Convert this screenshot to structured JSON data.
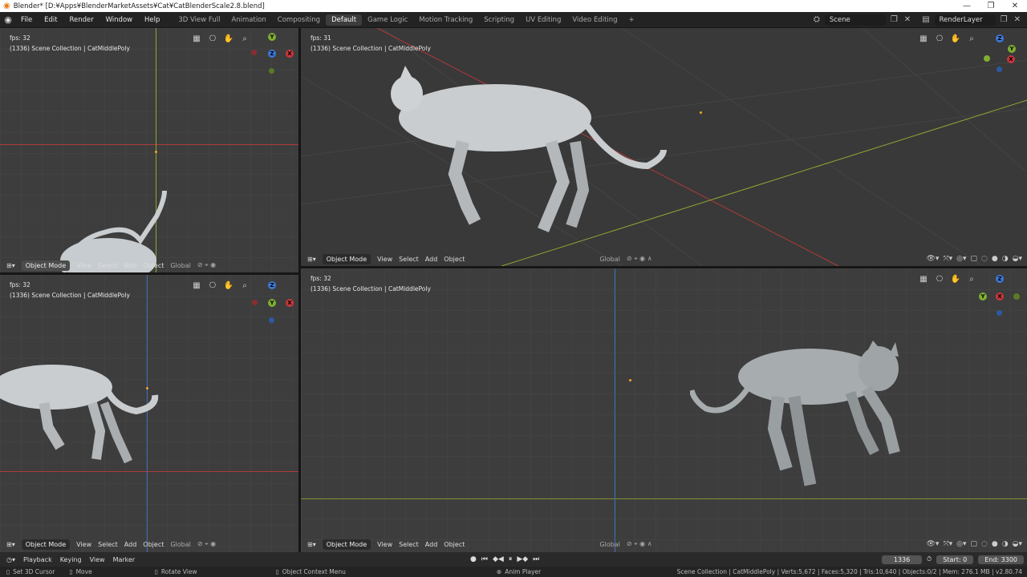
{
  "window": {
    "title": "Blender* [D:¥Apps¥BlenderMarketAssets¥Cat¥CatBlenderScale2.8.blend]",
    "controls": [
      "—",
      "❐",
      "✕"
    ]
  },
  "menu": [
    "File",
    "Edit",
    "Render",
    "Window",
    "Help"
  ],
  "workspaces": [
    "3D View Full",
    "Animation",
    "Compositing",
    "Default",
    "Game Logic",
    "Motion Tracking",
    "Scripting",
    "UV Editing",
    "Video Editing"
  ],
  "active_workspace": "Default",
  "scene": "Scene",
  "view_layer": "RenderLayer",
  "viewports": [
    {
      "fps": "fps: 32",
      "collection": "(1336) Scene Collection | CatMiddlePoly"
    },
    {
      "fps": "fps: 31",
      "collection": "(1336) Scene Collection | CatMiddlePoly"
    },
    {
      "fps": "fps: 32",
      "collection": "(1336) Scene Collection | CatMiddlePoly"
    },
    {
      "fps": "fps: 32",
      "collection": "(1336) Scene Collection | CatMiddlePoly"
    }
  ],
  "header": {
    "mode": "Object Mode",
    "view": "View",
    "select": "Select",
    "add": "Add",
    "object": "Object",
    "orientation": "Global"
  },
  "gizmo_labels": {
    "x": "X",
    "y": "Y",
    "z": "Z"
  },
  "timeline": {
    "playback": "Playback",
    "keying": "Keying",
    "view": "View",
    "marker": "Marker",
    "current_frame": "1336",
    "start_label": "Start:",
    "start": "0",
    "end_label": "End:",
    "end": "3300"
  },
  "status": {
    "set_cursor": "Set 3D Cursor",
    "move": "Move",
    "rotate": "Rotate View",
    "context": "Object Context Menu",
    "anim_player": "Anim Player",
    "stats": "Scene Collection | CatMiddlePoly | Verts:5,672 | Faces:5,320 | Tris:10,640 | Objects:0/2 | Mem: 276.1 MB | v2.80.74"
  },
  "colors": {
    "x_axis": "#c8373b",
    "y_axis": "#7fae32",
    "z_axis": "#3b78d8",
    "origin": "#f5a623",
    "accent": "#e87d0d"
  }
}
